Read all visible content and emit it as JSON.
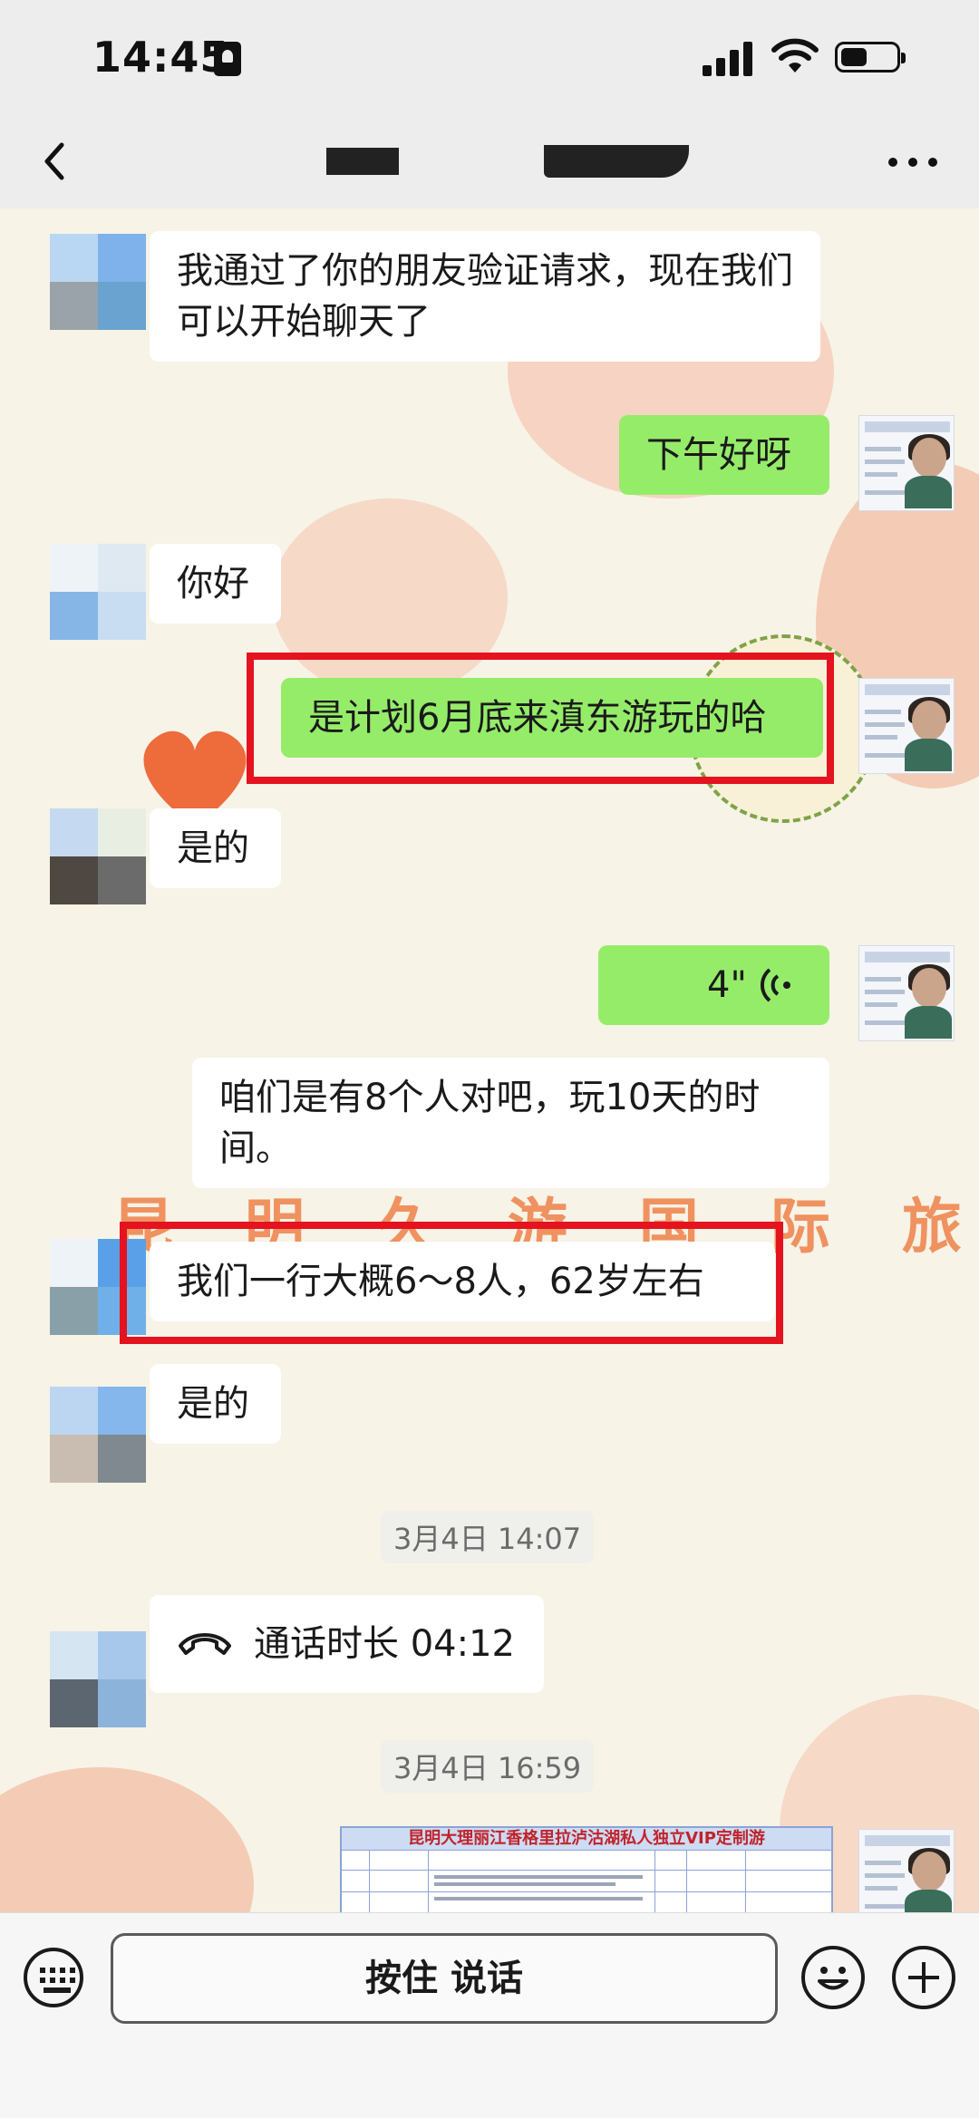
{
  "status_bar": {
    "time": "14:45"
  },
  "header": {
    "back_icon": "chevron-left-icon",
    "more_icon": "more-dots-icon"
  },
  "watermark": "昆 明 久 游 国 际 旅 行 社",
  "messages": [
    {
      "side": "in",
      "text": "我通过了你的朋友验证请求，现在我们可以开始聊天了"
    },
    {
      "side": "out",
      "text": "下午好呀"
    },
    {
      "side": "in",
      "text": "你好"
    },
    {
      "side": "out",
      "text": "是计划6月底来滇东游玩的哈",
      "highlighted": true
    },
    {
      "side": "in",
      "text": "是的"
    },
    {
      "side": "out",
      "type": "voice",
      "duration": "4\""
    },
    {
      "side": "in",
      "text": "咱们是有8个人对吧，玩10天的时间。"
    },
    {
      "side": "in",
      "text": "我们一行大概6～8人，62岁左右",
      "highlighted": true
    },
    {
      "side": "in",
      "text": "是的"
    },
    {
      "type": "timestamp",
      "text": "3月4日 14:07"
    },
    {
      "side": "in",
      "type": "call",
      "text": "通话时长 04:12"
    },
    {
      "type": "timestamp",
      "text": "3月4日 16:59"
    },
    {
      "side": "out",
      "type": "document",
      "title": "昆明大理丽江香格里拉泸沽湖私人独立VIP定制游"
    }
  ],
  "input_bar": {
    "hold_to_talk": "按住 说话",
    "keyboard_icon": "keyboard-icon",
    "emoji_icon": "emoji-icon",
    "plus_icon": "plus-icon"
  },
  "colors": {
    "incoming_bubble": "#ffffff",
    "outgoing_bubble": "#95ec69",
    "highlight_box": "#e4131f"
  }
}
